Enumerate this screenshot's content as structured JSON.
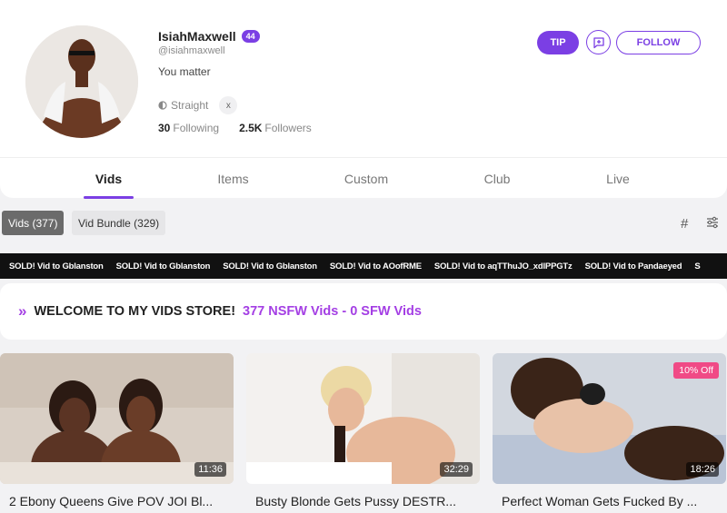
{
  "profile": {
    "username": "IsiahMaxwell",
    "level": "44",
    "handle": "@isiahmaxwell",
    "bio": "You matter",
    "orientation": "Straight",
    "x_icon": "x",
    "following_count": "30",
    "following_label": "Following",
    "followers_count": "2.5K",
    "followers_label": "Followers"
  },
  "actions": {
    "tip_label": "TIP",
    "follow_label": "FOLLOW"
  },
  "tabs": [
    {
      "label": "Vids",
      "active": true
    },
    {
      "label": "Items",
      "active": false
    },
    {
      "label": "Custom",
      "active": false
    },
    {
      "label": "Club",
      "active": false
    },
    {
      "label": "Live",
      "active": false
    }
  ],
  "filters": {
    "chips": [
      {
        "label": "Vids (377)",
        "active": true
      },
      {
        "label": "Vid Bundle (329)",
        "active": false
      }
    ],
    "grid_icon": "#"
  },
  "ticker": [
    "SOLD! Vid to Gblanston",
    "SOLD! Vid to Gblanston",
    "SOLD! Vid to Gblanston",
    "SOLD! Vid to AOofRME",
    "SOLD! Vid to aqTThuJO_xdlPPGTz",
    "SOLD! Vid to Pandaeyed",
    "S"
  ],
  "welcome": {
    "icon": "»",
    "text": "WELCOME TO MY VIDS STORE!",
    "highlight": "377 NSFW Vids - 0 SFW Vids"
  },
  "videos": [
    {
      "title": "2 Ebony Queens Give POV JOI Bl...",
      "duration": "11:36",
      "discount": ""
    },
    {
      "title": "Busty Blonde Gets Pussy DESTR...",
      "duration": "32:29",
      "discount": ""
    },
    {
      "title": "Perfect Woman Gets Fucked By ...",
      "duration": "18:26",
      "discount": "10% Off"
    }
  ],
  "colors": {
    "accent": "#7b3fe4",
    "highlight": "#a43fe4",
    "discount": "#f04a86"
  }
}
